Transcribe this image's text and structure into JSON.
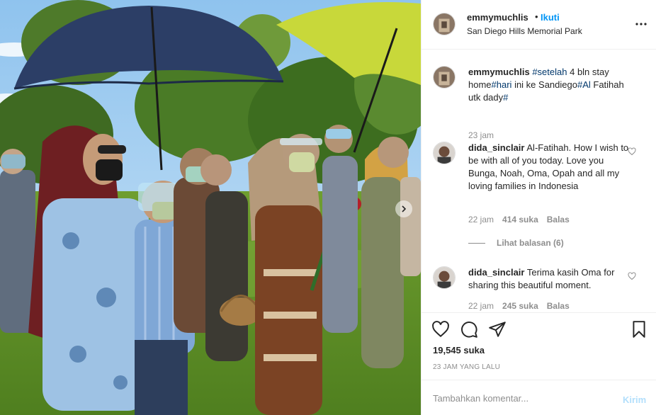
{
  "photo": {
    "alt_icon": "next-arrow-icon"
  },
  "header": {
    "username": "emmymuchlis",
    "separator": "•",
    "follow_label": "Ikuti",
    "location": "San Diego Hills Memorial Park",
    "more_icon": "more-options-icon"
  },
  "caption": {
    "username": "emmymuchlis",
    "segments": [
      {
        "text": "#setelah",
        "tag": true
      },
      {
        "text": " 4 bln stay home",
        "tag": false
      },
      {
        "text": "#hari",
        "tag": true
      },
      {
        "text": " ini ke Sandiego",
        "tag": false
      },
      {
        "text": "#Al",
        "tag": true
      },
      {
        "text": " Fatihah utk dady",
        "tag": false
      },
      {
        "text": "#",
        "tag": true
      }
    ],
    "time": "23 jam"
  },
  "comments": [
    {
      "username": "dida_sinclair",
      "text": "Al-Fatihah. How I wish to be with all of you today. Love you Bunga, Noah, Oma, Opah and all my loving families in Indonesia",
      "time": "22 jam",
      "likes": "414 suka",
      "reply": "Balas",
      "view_replies": "Lihat balasan (6)"
    },
    {
      "username": "dida_sinclair",
      "text": "Terima kasih Oma for sharing this beautiful moment.",
      "time": "22 jam",
      "likes": "245 suka",
      "reply": "Balas"
    }
  ],
  "actions": {
    "icons": [
      "heart-icon",
      "comment-icon",
      "share-icon",
      "bookmark-icon"
    ],
    "likes": "19,545 suka",
    "timeago": "23 JAM YANG LALU"
  },
  "add_comment": {
    "placeholder": "Tambahkan komentar...",
    "post_label": "Kirim"
  },
  "colors": {
    "link": "#0095f6",
    "hashtag": "#00376b",
    "muted": "#8e8e8e",
    "post_disabled": "#b2dffc"
  }
}
